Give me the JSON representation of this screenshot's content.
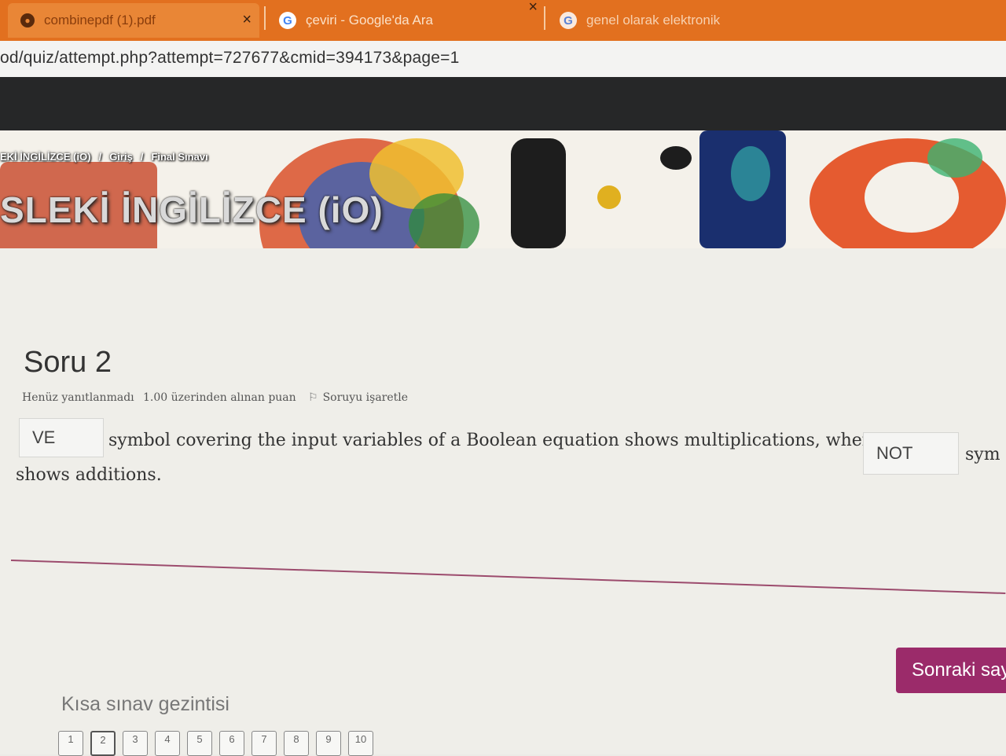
{
  "browser": {
    "tabs": [
      {
        "title": "combinepdf (1).pdf",
        "favicon": "acrobat-icon",
        "active": true
      },
      {
        "title": "çeviri - Google'da Ara",
        "favicon": "google-icon",
        "active": false
      },
      {
        "title": "genel olarak elektronik",
        "favicon": "google-icon",
        "active": false
      }
    ],
    "close_symbol": "×",
    "url": "od/quiz/attempt.php?attempt=727677&cmid=394173&page=1"
  },
  "banner": {
    "breadcrumb": [
      "EKİ İNGİLİZCE (iO)",
      "/",
      "Giriş",
      "/",
      "Final Sınavı"
    ],
    "course_title": "SLEKİ İNGİLİZCE (iO)"
  },
  "question": {
    "title": "Soru 2",
    "status": "Henüz yanıtlanmadı",
    "points": "1.00 üzerinden alınan puan",
    "flag_label": "Soruyu işaretle",
    "answer1": "VE",
    "text_part1": "symbol covering the input variables of a Boolean equation shows multiplications, whereas",
    "answer2": "NOT",
    "text_part2": "sym",
    "text_part3": "shows additions."
  },
  "next_button": "Sonraki say",
  "quiz_nav": {
    "title": "Kısa sınav gezintisi",
    "pages": [
      "1",
      "2",
      "3",
      "4",
      "5",
      "6",
      "7",
      "8",
      "9",
      "10"
    ]
  },
  "colors": {
    "tabbar": "#e2701f",
    "accent": "#9b2b6a",
    "divider": "#9c4b6d"
  }
}
